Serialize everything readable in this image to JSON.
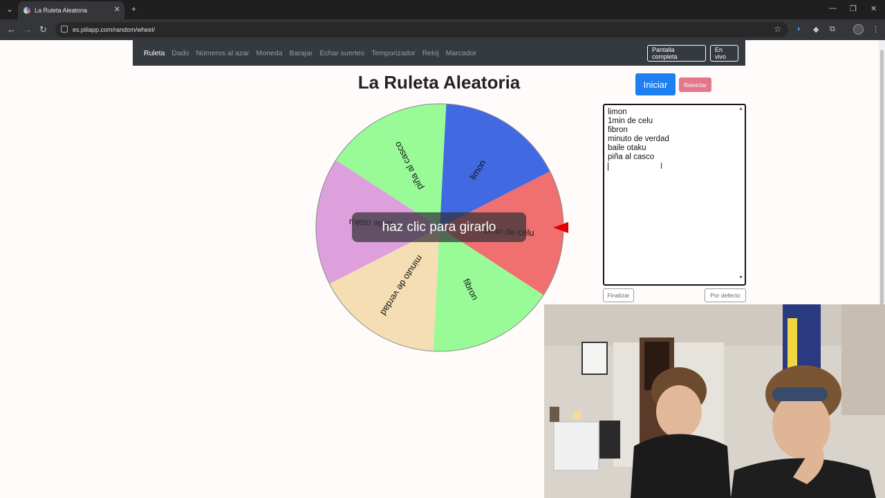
{
  "browser": {
    "tab_title": "La Ruleta Aleatoria",
    "tab_close": "✕",
    "new_tab": "+",
    "url": "es.piliapp.com/random/wheel/",
    "window_controls": [
      "—",
      "❐",
      "✕"
    ]
  },
  "nav": {
    "links": [
      "Ruleta",
      "Dado",
      "Números al azar",
      "Moneda",
      "Barajar",
      "Echar suertes",
      "Temporizador",
      "Reloj",
      "Marcador"
    ],
    "active": "Ruleta",
    "fullscreen_label": "Pantalla completa",
    "live_label": "En vivo"
  },
  "title": "La Ruleta Aleatoria",
  "wheel": {
    "overlay_text": "haz clic para girarlo",
    "segments": [
      {
        "label": "limon",
        "color": "#4169e1"
      },
      {
        "label": "1min de celu",
        "color": "#f07070"
      },
      {
        "label": "fibron",
        "color": "#98fb98"
      },
      {
        "label": "minuto de verdad",
        "color": "#f5deb3"
      },
      {
        "label": "baile otaku",
        "color": "#dda0dd"
      },
      {
        "label": "piña al casco",
        "color": "#98fb98"
      }
    ]
  },
  "controls": {
    "start_label": "Iniciar",
    "reset_label": "Reiniciar",
    "entries": [
      "limon",
      "1min de celu",
      "fibron",
      "minuto de verdad",
      "baile otaku",
      "piña al casco"
    ],
    "finish_label": "Finalizar",
    "default_label": "Por defecto"
  },
  "colors": {
    "navbar": "#343a40",
    "primary": "#1e7ff0",
    "reset": "#e3788a",
    "pointer": "#e00000"
  }
}
